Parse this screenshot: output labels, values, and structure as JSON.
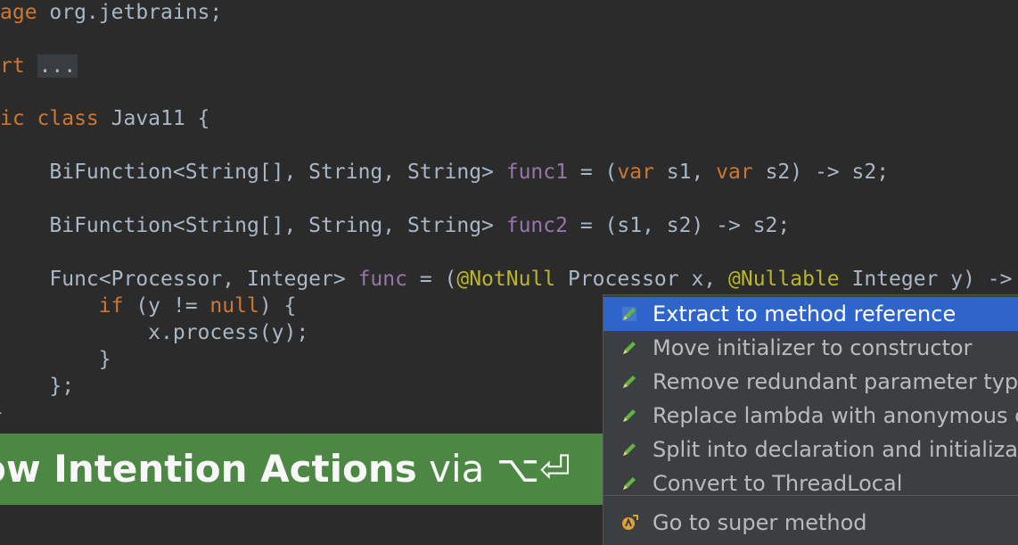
{
  "code": {
    "l1": {
      "kw": "age",
      "rest": " org.jetbrains;"
    },
    "l2": {
      "kw": "rt",
      "fold": "..."
    },
    "l3": {
      "kw": "ic class",
      "rest": " Java11 {"
    },
    "l4": {
      "pre": "    BiFunction<String[], String, String> ",
      "fld": "func1",
      "mid": " = (",
      "kw1": "var",
      "s1": " s1, ",
      "kw2": "var",
      "end": " s2) -> s2;"
    },
    "l5": {
      "pre": "    BiFunction<String[], String, String> ",
      "fld": "func2",
      "end": " = (s1, s2) -> s2;"
    },
    "l6": {
      "pre": "    Func<Processor, Integer> ",
      "fld": "func",
      "mid": " = (",
      "ann1": "@NotNull",
      "p1": " Processor x, ",
      "ann2": "@Nullable",
      "end": " Integer y) ->"
    },
    "l7": {
      "pre": "        ",
      "kw": "if",
      "mid": " (y != ",
      "kw2": "null",
      "end": ") {"
    },
    "l8": {
      "text": "            x.process(y);"
    },
    "l9": {
      "text": "        }"
    },
    "l10": {
      "text": "    };"
    },
    "l11": {
      "text": "}"
    }
  },
  "banner": {
    "bold": "ow Intention Actions",
    "rest": " via ⌥⏎"
  },
  "popup": {
    "items": [
      {
        "label": "Extract to method reference",
        "icon": "pencil-icon"
      },
      {
        "label": "Move initializer to constructor",
        "icon": "pencil-icon"
      },
      {
        "label": "Remove redundant parameter types",
        "icon": "pencil-icon"
      },
      {
        "label": "Replace lambda with anonymous class",
        "icon": "pencil-icon"
      },
      {
        "label": "Split into declaration and initialization",
        "icon": "pencil-icon"
      },
      {
        "label": "Convert to ThreadLocal",
        "icon": "pencil-icon"
      },
      {
        "label": "Go to super method",
        "icon": "super-method-icon"
      }
    ]
  },
  "colors": {
    "background": "#2b2b2b",
    "keyword": "#cc7832",
    "field": "#9876aa",
    "annotation": "#bbb529",
    "selection": "#2f65ca",
    "banner": "#4e8a45"
  }
}
